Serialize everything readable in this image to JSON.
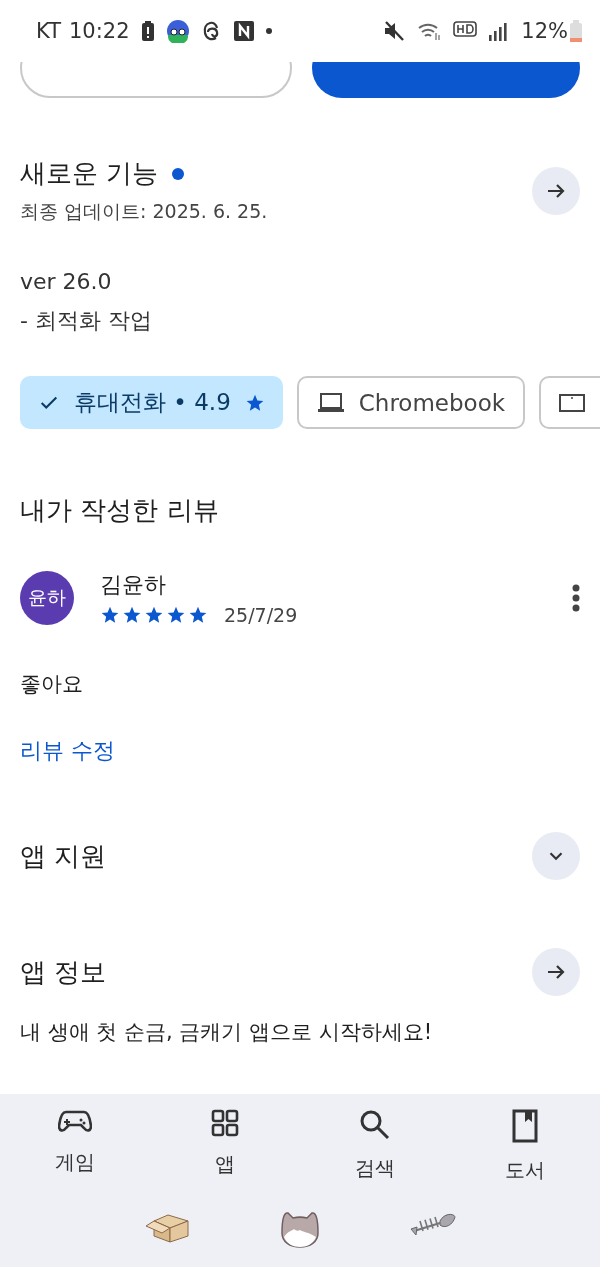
{
  "status_bar": {
    "carrier": "KT",
    "time": "10:22",
    "battery": "12%"
  },
  "top_buttons": [
    {
      "kind": "outline"
    },
    {
      "kind": "filled"
    }
  ],
  "whats_new": {
    "title": "새로운 기능",
    "new_dot": true,
    "updated": "최종 업데이트: 2025. 6. 25.",
    "lines": [
      "ver 26.0",
      "- 최적화 작업"
    ]
  },
  "device_chips": [
    {
      "kind": "phone",
      "label": "휴대전화 • 4.9",
      "selected": true
    },
    {
      "kind": "laptop",
      "label": "Chromebook",
      "selected": false
    },
    {
      "kind": "tablet",
      "selected": false
    }
  ],
  "my_review": {
    "title": "내가 작성한 리뷰",
    "avatar": "윤하",
    "name": "김윤하",
    "stars": 5,
    "date": "25/7/29",
    "text": "좋아요",
    "edit_link": "리뷰 수정"
  },
  "sections": [
    {
      "kind": "expand",
      "title": "앱 지원",
      "expanded": false
    },
    {
      "kind": "link",
      "title": "앱 정보",
      "text": "내 생애 첫 순금, 금캐기 앱으로 시작하세요!"
    }
  ],
  "nav": [
    {
      "kind": "games",
      "label": "게임",
      "selected": false
    },
    {
      "kind": "apps",
      "label": "앱",
      "selected": false
    },
    {
      "kind": "search",
      "label": "검색",
      "selected": false
    },
    {
      "kind": "books",
      "label": "도서",
      "selected": false
    }
  ],
  "gesture_bar": [
    {
      "kind": "box"
    },
    {
      "kind": "cat"
    },
    {
      "kind": "fish"
    }
  ]
}
